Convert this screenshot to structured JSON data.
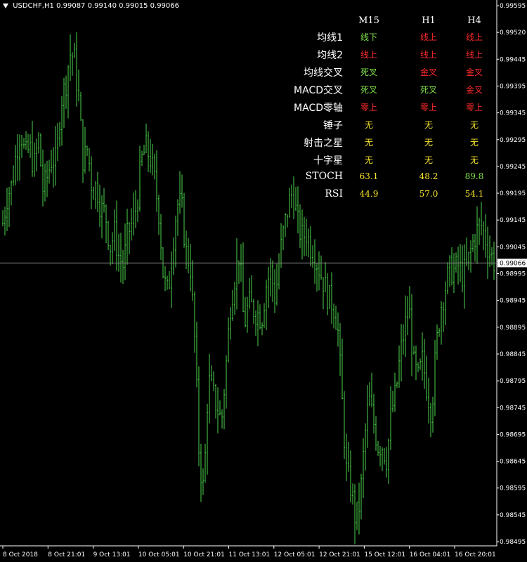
{
  "header": {
    "symbol": "USDCHF,H1",
    "ohlc": "0.99087 0.99140 0.99015 0.99066"
  },
  "colors": {
    "background": "#000000",
    "bar": "#4cd44c",
    "price_line": "#8d8d8d",
    "price_tag_bg": "#ffffff",
    "green": "#7ee04a",
    "red": "#ff2a2a",
    "yellow": "#f5e32c"
  },
  "price_axis": {
    "labels": [
      "0.99595",
      "0.99520",
      "0.99445",
      "0.99395",
      "0.99345",
      "0.99295",
      "0.99245",
      "0.99195",
      "0.99145",
      "0.99045",
      "0.98995",
      "0.98945",
      "0.98895",
      "0.98845",
      "0.98795",
      "0.98745",
      "0.98695",
      "0.98645",
      "0.98595",
      "0.98545",
      "0.98495"
    ],
    "current": "0.99066"
  },
  "time_axis": {
    "labels": [
      "8 Oct 2018",
      "8 Oct 21:01",
      "9 Oct 13:01",
      "10 Oct 05:01",
      "10 Oct 21:01",
      "11 Oct 13:01",
      "12 Oct 05:01",
      "12 Oct 21:01",
      "15 Oct 12:01",
      "16 Oct 04:01",
      "16 Oct 20:01"
    ]
  },
  "dashboard": {
    "columns": [
      "M15",
      "H1",
      "H4"
    ],
    "rows": [
      {
        "label": "均线1",
        "cells": [
          {
            "text": "线下",
            "color": "green"
          },
          {
            "text": "线上",
            "color": "red"
          },
          {
            "text": "线上",
            "color": "red"
          }
        ]
      },
      {
        "label": "均线2",
        "cells": [
          {
            "text": "线上",
            "color": "red"
          },
          {
            "text": "线上",
            "color": "red"
          },
          {
            "text": "线上",
            "color": "red"
          }
        ]
      },
      {
        "label": "均线交叉",
        "cells": [
          {
            "text": "死叉",
            "color": "green"
          },
          {
            "text": "金叉",
            "color": "red"
          },
          {
            "text": "金叉",
            "color": "red"
          }
        ]
      },
      {
        "label": "MACD交叉",
        "cells": [
          {
            "text": "死叉",
            "color": "green"
          },
          {
            "text": "死叉",
            "color": "green"
          },
          {
            "text": "金叉",
            "color": "red"
          }
        ]
      },
      {
        "label": "MACD零轴",
        "cells": [
          {
            "text": "零上",
            "color": "red"
          },
          {
            "text": "零上",
            "color": "red"
          },
          {
            "text": "零上",
            "color": "red"
          }
        ]
      },
      {
        "label": "锤子",
        "cells": [
          {
            "text": "无",
            "color": "yellow"
          },
          {
            "text": "无",
            "color": "yellow"
          },
          {
            "text": "无",
            "color": "yellow"
          }
        ]
      },
      {
        "label": "射击之星",
        "cells": [
          {
            "text": "无",
            "color": "yellow"
          },
          {
            "text": "无",
            "color": "yellow"
          },
          {
            "text": "无",
            "color": "yellow"
          }
        ]
      },
      {
        "label": "十字星",
        "cells": [
          {
            "text": "无",
            "color": "yellow"
          },
          {
            "text": "无",
            "color": "yellow"
          },
          {
            "text": "无",
            "color": "yellow"
          }
        ]
      },
      {
        "label": "STOCH",
        "cells": [
          {
            "text": "63.1",
            "color": "yellow"
          },
          {
            "text": "48.2",
            "color": "yellow"
          },
          {
            "text": "89.8",
            "color": "green"
          }
        ]
      },
      {
        "label": "RSI",
        "cells": [
          {
            "text": "44.9",
            "color": "yellow"
          },
          {
            "text": "57.0",
            "color": "yellow"
          },
          {
            "text": "54.1",
            "color": "yellow"
          }
        ]
      }
    ]
  },
  "chart_data": {
    "type": "candlestick",
    "symbol": "USDCHF",
    "timeframe": "H1",
    "ylim": [
      0.9847,
      0.9962
    ],
    "current_price": 0.99066,
    "price_series_approx": [
      0.9915,
      0.9921,
      0.9923,
      0.993,
      0.9935,
      0.9929,
      0.9931,
      0.9927,
      0.9933,
      0.9922,
      0.9925,
      0.9929,
      0.9928,
      0.9941,
      0.9944,
      0.9951,
      0.995,
      0.9941,
      0.9928,
      0.9931,
      0.9922,
      0.9923,
      0.9918,
      0.9917,
      0.991,
      0.9913,
      0.9908,
      0.9906,
      0.9913,
      0.9915,
      0.9919,
      0.9928,
      0.9931,
      0.9929,
      0.9924,
      0.9917,
      0.9903,
      0.99,
      0.991,
      0.9919,
      0.9919,
      0.9909,
      0.9906,
      0.989,
      0.9865,
      0.9858,
      0.9882,
      0.9879,
      0.9876,
      0.9873,
      0.9885,
      0.9898,
      0.9904,
      0.9909,
      0.9893,
      0.9898,
      0.9897,
      0.9896,
      0.9895,
      0.9902,
      0.9905,
      0.9899,
      0.9908,
      0.9914,
      0.9919,
      0.9922,
      0.9915,
      0.9912,
      0.9913,
      0.991,
      0.9908,
      0.9905,
      0.9902,
      0.9899,
      0.9898,
      0.9893,
      0.9877,
      0.9862,
      0.9859,
      0.9852,
      0.9856,
      0.9869,
      0.9878,
      0.9873,
      0.9868,
      0.9868,
      0.9865,
      0.9875,
      0.9879,
      0.9887,
      0.9893,
      0.9897,
      0.9885,
      0.9882,
      0.9886,
      0.988,
      0.9875,
      0.9888,
      0.9897,
      0.9901,
      0.9905,
      0.9905,
      0.9906,
      0.9904,
      0.9906,
      0.991,
      0.9913,
      0.9915,
      0.9912,
      0.9909,
      0.9907
    ]
  }
}
